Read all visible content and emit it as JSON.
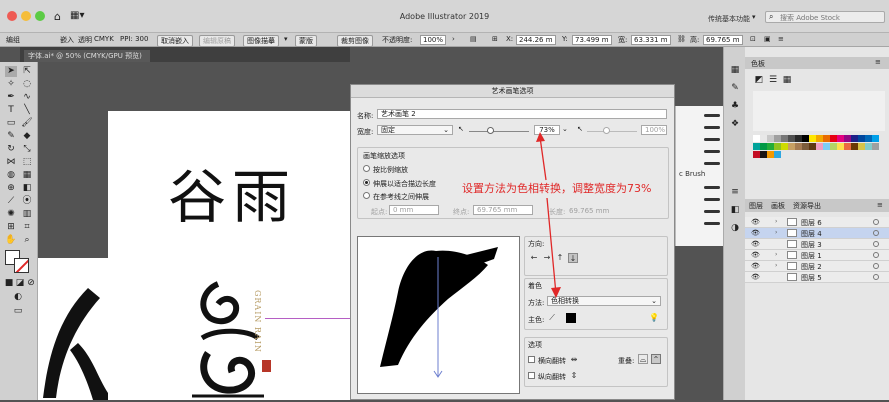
{
  "window": {
    "title": "Adobe Illustrator 2019",
    "workspace": "传统基本功能",
    "search_placeholder": "搜索 Adobe Stock"
  },
  "control_bar": {
    "mode": "编组",
    "embed": "嵌入",
    "transparency": "透明",
    "color_mode": "CMYK",
    "ppi": "PPI: 300",
    "unembed": "取消嵌入",
    "edit_original": "编辑原稿",
    "image_trace": "图像描摹",
    "mask": "蒙版",
    "crop_image": "裁剪图像",
    "opacity_label": "不透明度:",
    "opacity_value": "100%",
    "x_label": "X:",
    "x_value": "244.26 m",
    "y_label": "Y:",
    "y_value": "73.499 m",
    "w_label": "宽:",
    "w_value": "63.331 m",
    "h_label": "高:",
    "h_value": "69.765 m"
  },
  "doc_tab": {
    "label": "字体.ai* @ 50% (CMYK/GPU 预览)"
  },
  "artwork": {
    "title_chars": "谷雨",
    "grain_text": "GRAIN RAIN"
  },
  "brush_panel": {
    "visible_text": "c Brush"
  },
  "swatches_panel": {
    "tab": "色板",
    "colors": [
      "#ffffff",
      "#e8e8e8",
      "#c8c8c8",
      "#a0a0a0",
      "#787878",
      "#505050",
      "#282828",
      "#000000",
      "#ffe600",
      "#f4a700",
      "#e96b00",
      "#e60012",
      "#e4007f",
      "#920783",
      "#1d2088",
      "#00479d",
      "#0068b7",
      "#00a0e9",
      "#00a29a",
      "#009944",
      "#22ac38",
      "#8fc31f",
      "#cfdb00",
      "#c8a063",
      "#a67c52",
      "#7d5d3b",
      "#603813",
      "#f19ec2",
      "#7ecef4",
      "#b3d465",
      "#ffe04d",
      "#ec6941",
      "#6a3906",
      "#d7c447",
      "#84ccc9",
      "#9fa0a0",
      "#c30d23",
      "#1a1311",
      "#f39800",
      "#2ea7e0"
    ]
  },
  "layers_panel": {
    "tabs": [
      "图层",
      "画板",
      "资源导出"
    ],
    "layers": [
      {
        "name": "图层 6",
        "selected": false
      },
      {
        "name": "图层 4",
        "selected": true
      },
      {
        "name": "图层 3",
        "selected": false
      },
      {
        "name": "图层 1",
        "selected": false
      },
      {
        "name": "图层 2",
        "selected": false
      },
      {
        "name": "图层 5",
        "selected": false
      }
    ]
  },
  "dialog": {
    "title": "艺术画笔选项",
    "name_label": "名称:",
    "name_value": "艺术画笔 2",
    "width_label": "宽度:",
    "width_mode": "固定",
    "width_value": "73%",
    "width_max": "100%",
    "scale_group_title": "画笔缩放选项",
    "scale_opt1": "按比例缩放",
    "scale_opt2": "伸展以适合描边长度",
    "scale_opt3": "在参考线之间伸展",
    "start_label": "起点:",
    "start_value": "0 mm",
    "end_label": "终点:",
    "end_value": "69.765 mm",
    "length_label": "长度:",
    "length_value": "69.765 mm",
    "direction_label": "方向:",
    "colorize_title": "着色",
    "method_label": "方法:",
    "method_value": "色相转换",
    "keycolor_label": "主色:",
    "options_title": "选项",
    "flip_h": "横向翻转",
    "flip_v": "纵向翻转",
    "overlap_label": "重叠:"
  },
  "annotation": {
    "text": "设置方法为色相转换，调整宽度为73%",
    "color": "#e02828"
  }
}
